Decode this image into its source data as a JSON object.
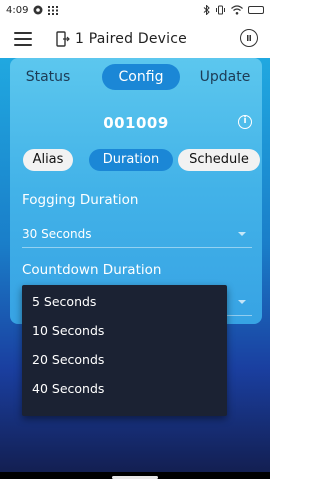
{
  "status_bar": {
    "time": "4:09",
    "icons_left": [
      "app-notification-icon",
      "grid-icon"
    ],
    "icons_right": [
      "bluetooth-icon",
      "vibrate-icon",
      "wifi-icon",
      "battery-icon"
    ]
  },
  "app_bar": {
    "title": "1 Paired Device",
    "menu_icon": "hamburger-menu-icon",
    "device_icon": "device-exit-icon",
    "power_icon": "power-icon"
  },
  "tabs": [
    {
      "label": "Status",
      "active": false
    },
    {
      "label": "Config",
      "active": true
    },
    {
      "label": "Update",
      "active": false
    }
  ],
  "device_id": "001009",
  "info_symbol": "i",
  "sub_tabs": [
    {
      "label": "Alias",
      "active": false
    },
    {
      "label": "Duration",
      "active": true
    },
    {
      "label": "Schedule",
      "active": false
    }
  ],
  "fogging": {
    "label": "Fogging Duration",
    "value": "30 Seconds"
  },
  "countdown": {
    "label": "Countdown Duration",
    "value": ""
  },
  "dropdown_options": [
    "5 Seconds",
    "10 Seconds",
    "20 Seconds",
    "40 Seconds"
  ],
  "colors": {
    "accent": "#1b87d6",
    "background_top": "#20a8e0",
    "background_bottom": "#131f52",
    "dropdown_bg": "#1b2233"
  }
}
